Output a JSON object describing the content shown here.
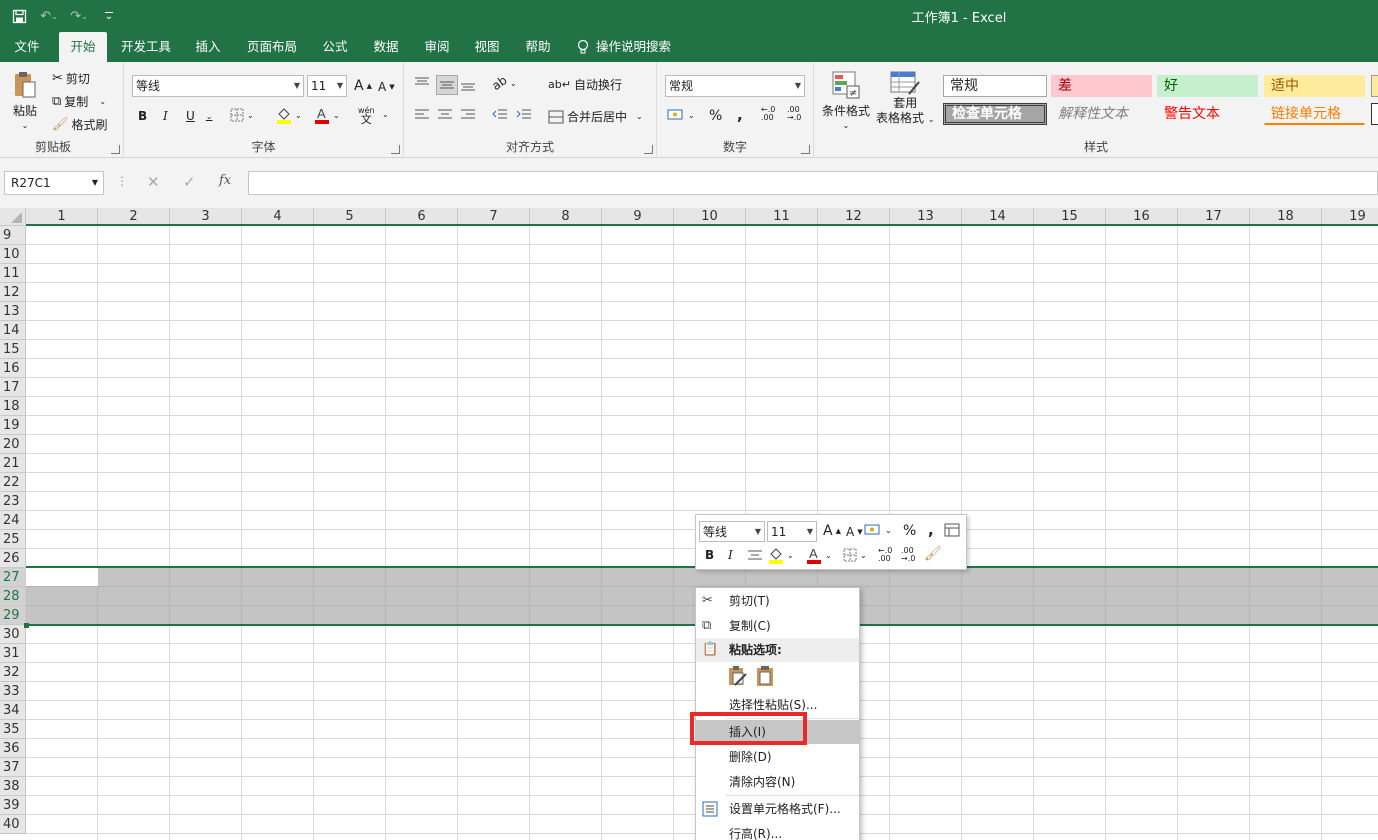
{
  "window": {
    "title": "工作簿1  -  Excel"
  },
  "qat": {
    "save": "💾",
    "undo": "↶",
    "redo": "↷",
    "custom": "⌄"
  },
  "tabs": [
    "文件",
    "开始",
    "开发工具",
    "插入",
    "页面布局",
    "公式",
    "数据",
    "审阅",
    "视图",
    "帮助"
  ],
  "tell_me": "操作说明搜索",
  "ribbon": {
    "clipboard": {
      "paste": "粘贴",
      "cut": "剪切",
      "copy": "复制",
      "format_painter": "格式刷",
      "label": "剪贴板"
    },
    "font": {
      "name": "等线",
      "size": "11",
      "bold": "B",
      "italic": "I",
      "underline": "U",
      "grow": "A",
      "shrink": "A",
      "phonetic": "wén",
      "label": "字体"
    },
    "alignment": {
      "wrap": "自动换行",
      "merge": "合并后居中",
      "label": "对齐方式"
    },
    "number": {
      "format": "常规",
      "percent": "%",
      "comma": ",",
      "inc": ".0\n.00",
      "label": "数字"
    },
    "styles": {
      "conditional": "条件格式",
      "table_line1": "套用",
      "table_line2": "表格格式",
      "label": "样式",
      "boxes": [
        {
          "text": "常规"
        },
        {
          "text": "差"
        },
        {
          "text": "好"
        },
        {
          "text": "适中"
        },
        {
          "text": "检查单元格"
        },
        {
          "text": "解释性文本"
        },
        {
          "text": "警告文本"
        },
        {
          "text": "链接单元格"
        }
      ]
    }
  },
  "formula_bar": {
    "name_box": "R27C1",
    "cancel": "✕",
    "enter": "✓",
    "fx": "fx",
    "value": ""
  },
  "grid": {
    "columns": [
      "1",
      "2",
      "3",
      "4",
      "5",
      "6",
      "7",
      "8",
      "9",
      "10",
      "11",
      "12",
      "13",
      "14",
      "15",
      "16",
      "17",
      "18",
      "19"
    ],
    "rows": [
      "9",
      "10",
      "11",
      "12",
      "13",
      "14",
      "15",
      "16",
      "17",
      "18",
      "19",
      "20",
      "21",
      "22",
      "23",
      "24",
      "25",
      "26",
      "27",
      "28",
      "29",
      "30",
      "31",
      "32",
      "33",
      "34",
      "35",
      "36",
      "37",
      "38",
      "39",
      "40"
    ],
    "selected_rows": [
      "27",
      "28",
      "29"
    ]
  },
  "mini_toolbar": {
    "font": "等线",
    "size": "11",
    "bold": "B",
    "italic": "I",
    "percent": "%",
    "comma": ","
  },
  "context_menu": {
    "cut": "剪切(T)",
    "copy": "复制(C)",
    "paste_header": "粘贴选项:",
    "paste_special": "选择性粘贴(S)...",
    "insert": "插入(I)",
    "delete": "删除(D)",
    "clear": "清除内容(N)",
    "format_cells": "设置单元格格式(F)...",
    "row_height": "行高(R)..."
  }
}
